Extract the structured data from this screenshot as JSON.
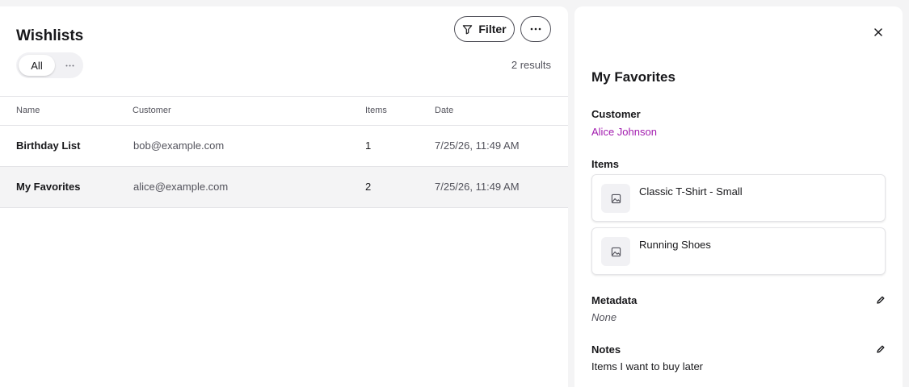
{
  "header": {
    "title": "Wishlists",
    "filter_label": "Filter"
  },
  "segments": {
    "all_label": "All"
  },
  "results_text": "2 results",
  "table": {
    "columns": [
      "Name",
      "Customer",
      "Items",
      "Date"
    ],
    "rows": [
      {
        "name": "Birthday List",
        "customer": "bob@example.com",
        "items": "1",
        "date": "7/25/26, 11:49 AM"
      },
      {
        "name": "My Favorites",
        "customer": "alice@example.com",
        "items": "2",
        "date": "7/25/26, 11:49 AM"
      }
    ]
  },
  "detail": {
    "title": "My Favorites",
    "customer_label": "Customer",
    "customer_name": "Alice Johnson",
    "items_label": "Items",
    "items": [
      "Classic T-Shirt - Small",
      "Running Shoes"
    ],
    "metadata_label": "Metadata",
    "metadata_value": "None",
    "notes_label": "Notes",
    "notes_value": "Items I want to buy later"
  },
  "colors": {
    "accent_link": "#a21caf",
    "border": "#e4e4e7",
    "selected_row": "#f4f4f5"
  },
  "icons": {
    "filter": "filter-icon",
    "more": "more-icon",
    "close": "close-icon",
    "image": "image-placeholder-icon",
    "edit": "edit-pencil-icon"
  }
}
